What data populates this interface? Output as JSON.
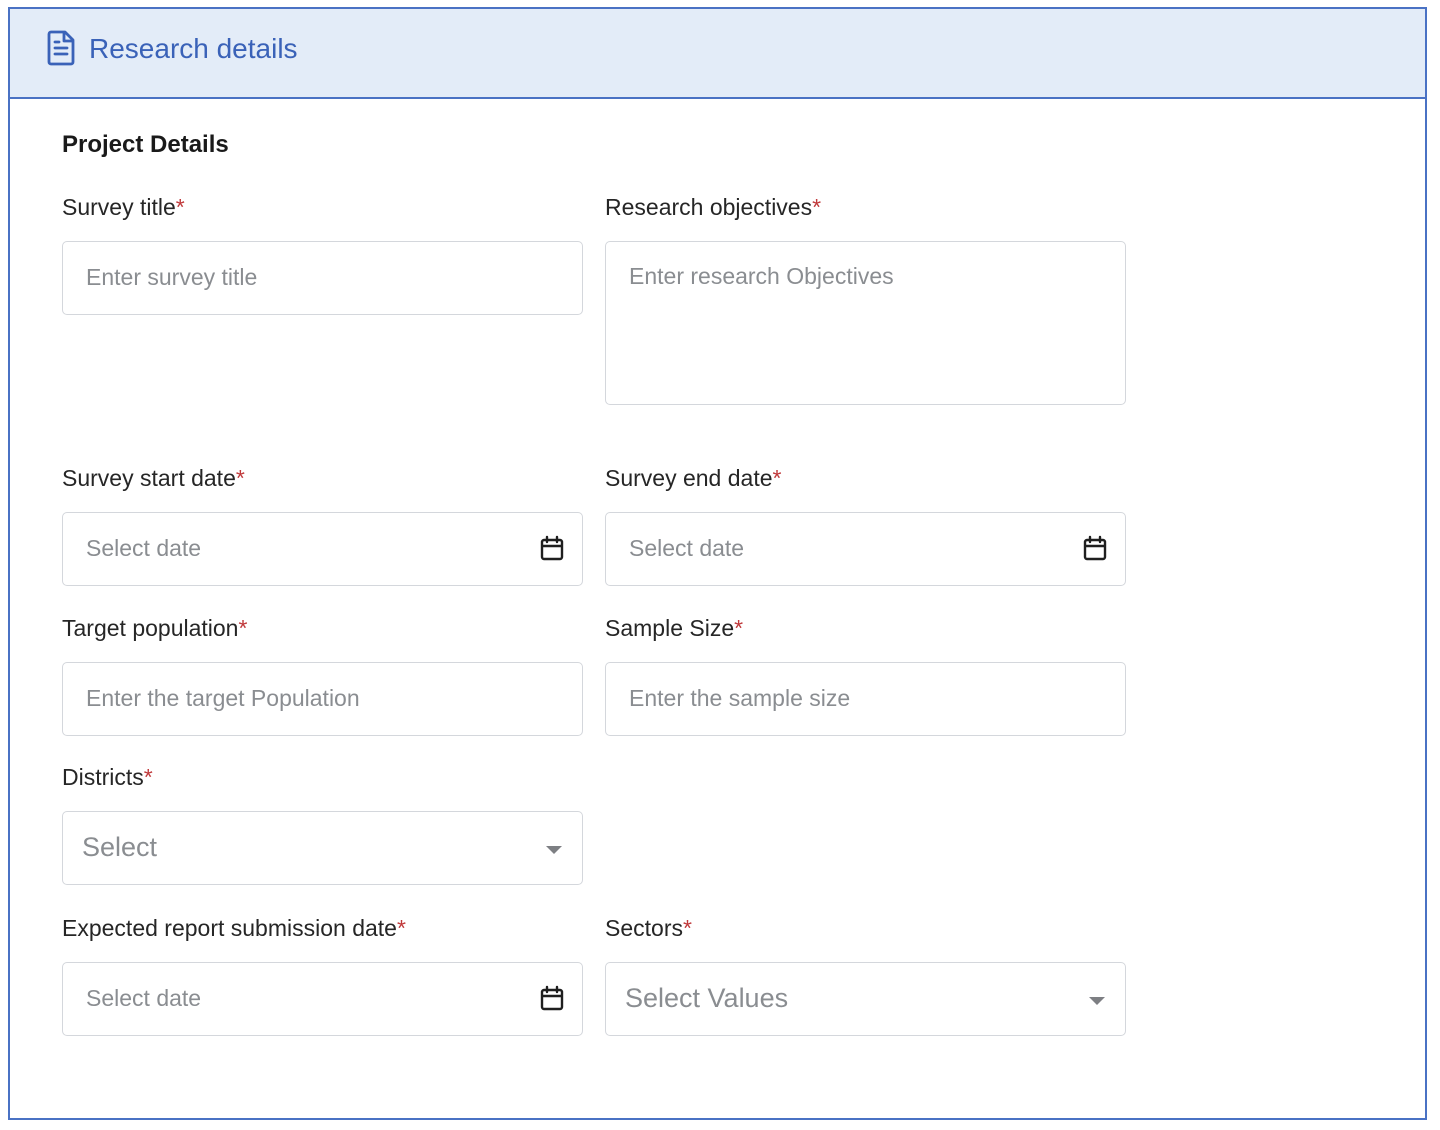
{
  "header": {
    "title": "Research details",
    "icon": "document-icon",
    "accent_color": "#3a62b8",
    "background_color": "#e3ecf8"
  },
  "section": {
    "title": "Project Details"
  },
  "required_mark": "*",
  "fields": {
    "survey_title": {
      "label": "Survey title",
      "placeholder": "Enter survey title"
    },
    "research_objectives": {
      "label": "Research objectives",
      "placeholder": "Enter research Objectives"
    },
    "survey_start_date": {
      "label": "Survey start date",
      "placeholder": "Select date",
      "icon": "calendar-icon"
    },
    "survey_end_date": {
      "label": "Survey end date",
      "placeholder": "Select date",
      "icon": "calendar-icon"
    },
    "target_population": {
      "label": "Target population",
      "placeholder": "Enter the target Population"
    },
    "sample_size": {
      "label": "Sample Size",
      "placeholder": "Enter the sample size"
    },
    "districts": {
      "label": "Districts",
      "placeholder": "Select",
      "icon": "caret-down-icon"
    },
    "report_submission_date": {
      "label": "Expected report submission date",
      "placeholder": "Select date",
      "icon": "calendar-icon"
    },
    "sectors": {
      "label": "Sectors",
      "placeholder": "Select Values",
      "icon": "caret-down-icon"
    }
  }
}
